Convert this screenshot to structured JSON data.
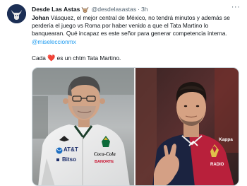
{
  "tweet": {
    "display_name": "Desde Las Astas",
    "handle": "@desdelasastas",
    "separator": "·",
    "time": "3h",
    "more_label": "···",
    "mention_author": "Johan",
    "paragraph1_rest": " Vásquez, el mejor central de México, no tendrá minutos y además se perdería el juego vs Roma por haber venido a que el Tata Martino lo banquearan. Qué incapaz es este señor para generar competencia interna.",
    "mention": "@miseleccionmx",
    "paragraph2_before": "Cada ",
    "heart_icon": "red-heart",
    "paragraph2_after": " es un chtm Tata Martino."
  },
  "media": {
    "left_photo": {
      "sponsors": [
        "AT&T",
        "Coca-Cola",
        "Bitso",
        "BANORTE"
      ]
    },
    "right_photo": {
      "sponsors": [
        "Kappa",
        "RADIO"
      ]
    }
  },
  "colors": {
    "link": "#1d9bf0",
    "text": "#0f1419",
    "secondary": "#536471",
    "heart": "#e0245e",
    "genoa_red": "#b8203b",
    "genoa_navy": "#1b2340"
  }
}
